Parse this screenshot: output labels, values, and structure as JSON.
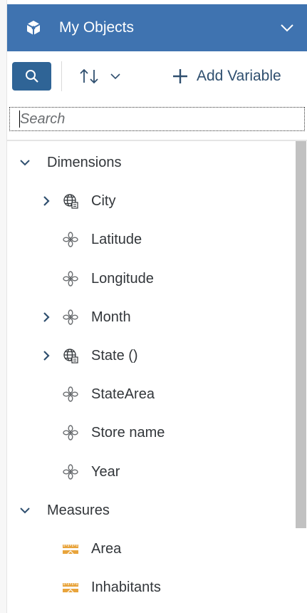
{
  "header": {
    "title": "My Objects"
  },
  "toolbar": {
    "add_variable_label": "Add Variable"
  },
  "search": {
    "placeholder": "Search"
  },
  "tree": {
    "sections": [
      {
        "label": "Dimensions",
        "expanded": true,
        "items": [
          {
            "label": "City",
            "icon": "globe-icon",
            "expandable": true
          },
          {
            "label": "Latitude",
            "icon": "dimension-icon",
            "expandable": false
          },
          {
            "label": "Longitude",
            "icon": "dimension-icon",
            "expandable": false
          },
          {
            "label": "Month",
            "icon": "dimension-icon",
            "expandable": true
          },
          {
            "label": "State ()",
            "icon": "globe-icon",
            "expandable": true
          },
          {
            "label": "StateArea",
            "icon": "dimension-icon",
            "expandable": false
          },
          {
            "label": "Store name",
            "icon": "dimension-icon",
            "expandable": false
          },
          {
            "label": "Year",
            "icon": "dimension-icon",
            "expandable": false
          }
        ]
      },
      {
        "label": "Measures",
        "expanded": true,
        "items": [
          {
            "label": "Area",
            "icon": "measure-icon",
            "expandable": false
          },
          {
            "label": "Inhabitants",
            "icon": "measure-icon",
            "expandable": false
          }
        ]
      }
    ]
  },
  "colors": {
    "header_bg": "#3f73b0",
    "search_button_bg": "#2f6496",
    "dimension_icon": "#6a6d70",
    "measure_icon": "#e8a43c",
    "chevron": "#2f6496"
  }
}
